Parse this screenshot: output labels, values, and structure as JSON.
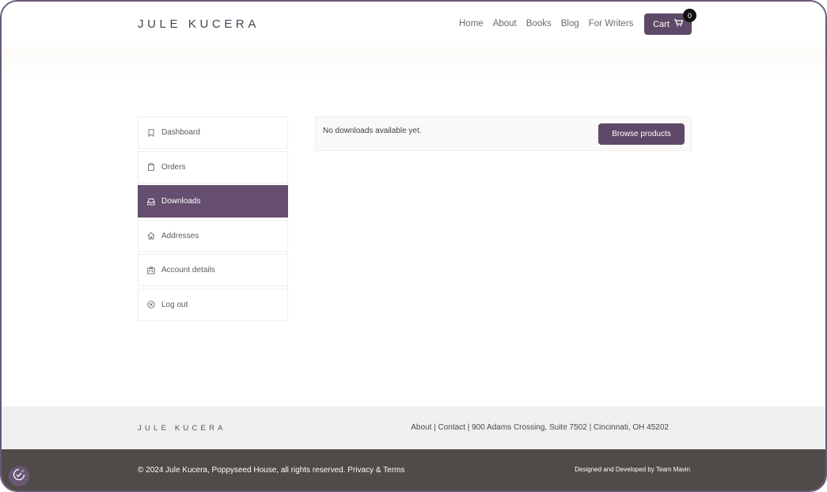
{
  "brand": {
    "logo": "JULE KUCERA"
  },
  "nav": {
    "items": [
      "Home",
      "About",
      "Books",
      "Blog",
      "For Writers"
    ]
  },
  "cart": {
    "label": "Cart",
    "count": "0"
  },
  "sidebar": {
    "items": [
      {
        "label": "Dashboard",
        "icon": "bookmark-icon",
        "active": false
      },
      {
        "label": "Orders",
        "icon": "clipboard-icon",
        "active": false
      },
      {
        "label": "Downloads",
        "icon": "inbox-icon",
        "active": true
      },
      {
        "label": "Addresses",
        "icon": "home-icon",
        "active": false
      },
      {
        "label": "Account details",
        "icon": "id-card-icon",
        "active": false
      },
      {
        "label": "Log out",
        "icon": "close-circle-icon",
        "active": false
      }
    ]
  },
  "main": {
    "notice": "No downloads available yet.",
    "browse_label": "Browse products"
  },
  "footer": {
    "logo": "JULE KUCERA",
    "links": {
      "about": "About",
      "sep1": " | ",
      "contact": "Contact",
      "sep2": " | ",
      "address": "900 Adams Crossing, Suite 7502 | Cincinnati, OH 45202"
    },
    "copyright_prefix": "© 2024 Jule Kucera, Poppyseed House, all rights reserved. ",
    "privacy_terms": "Privacy & Terms",
    "credits": "Designed and Developed by Team Mavin"
  },
  "colors": {
    "accent": "#5e4a68",
    "footer_dark": "#4e4b48",
    "footer_light": "#efefef"
  }
}
